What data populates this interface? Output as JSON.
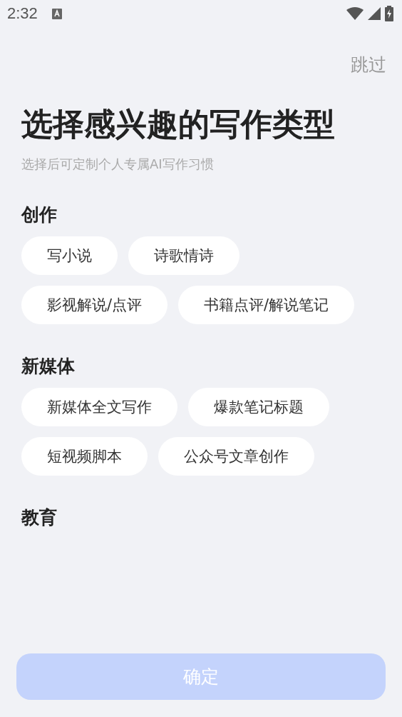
{
  "status_bar": {
    "time": "2:32"
  },
  "skip": "跳过",
  "title": "选择感兴趣的写作类型",
  "subtitle": "选择后可定制个人专属AI写作习惯",
  "sections": [
    {
      "heading": "创作",
      "chips": [
        {
          "label": "写小说",
          "selected": false
        },
        {
          "label": "诗歌情诗",
          "selected": false
        },
        {
          "label": "影视解说/点评",
          "selected": false
        },
        {
          "label": "书籍点评/解说笔记",
          "selected": false
        }
      ]
    },
    {
      "heading": "新媒体",
      "chips": [
        {
          "label": "新媒体全文写作",
          "selected": false
        },
        {
          "label": "爆款笔记标题",
          "selected": false
        },
        {
          "label": "短视频脚本",
          "selected": false
        },
        {
          "label": "公众号文章创作",
          "selected": false
        }
      ]
    },
    {
      "heading": "教育"
    }
  ],
  "confirm": {
    "label": "确定",
    "disabled": true
  }
}
